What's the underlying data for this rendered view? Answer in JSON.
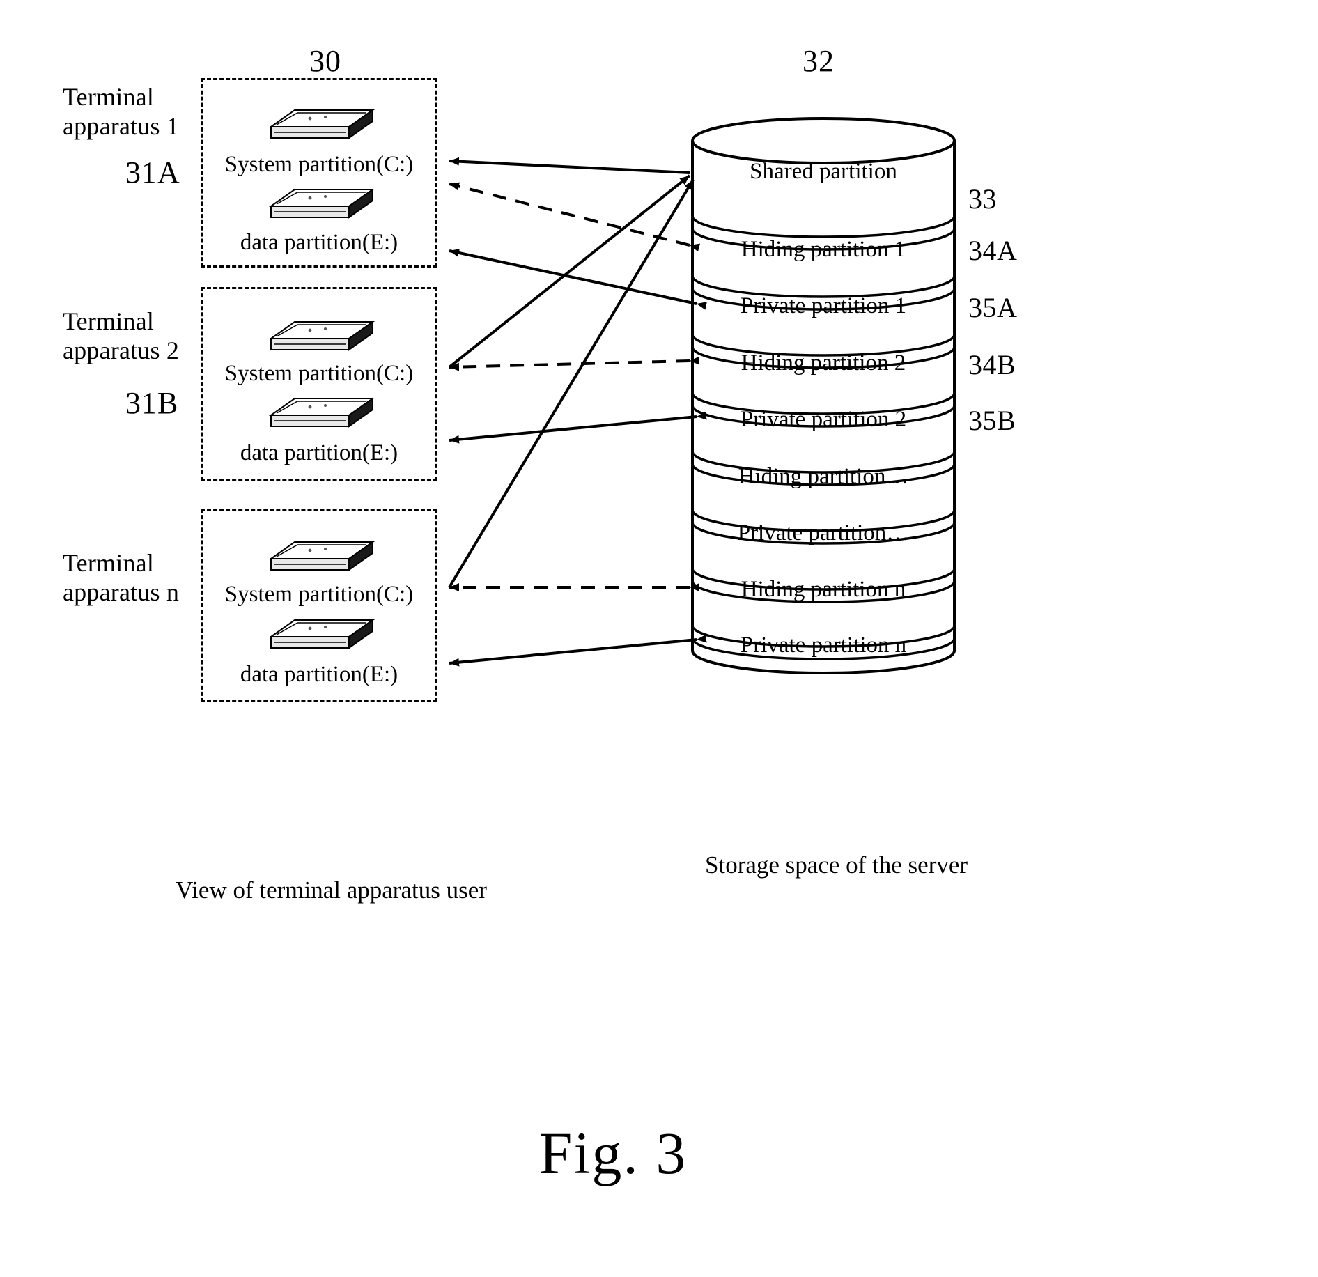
{
  "figure": {
    "number_label": "Fig. 3",
    "top_ref_left": "30",
    "top_ref_right": "32"
  },
  "left_side": {
    "terminals": [
      {
        "name": "Terminal\napparatus 1",
        "ref": "31A"
      },
      {
        "name": "Terminal\napparatus 2",
        "ref": "31B"
      },
      {
        "name": "Terminal\napparatus n",
        "ref": ""
      }
    ],
    "box_partitions": [
      {
        "system": "System partition(C:)",
        "data": "data  partition(E:)"
      },
      {
        "system": "System partition(C:)",
        "data": "data  partition(E:)"
      },
      {
        "system": "System partition(C:)",
        "data": "data  partition(E:)"
      }
    ],
    "caption": "View of terminal apparatus user"
  },
  "server": {
    "caption": "Storage space of the server",
    "partitions": [
      {
        "label": "Shared partition",
        "ref": "33"
      },
      {
        "label": "Hiding partition 1",
        "ref": "34A"
      },
      {
        "label": "Private partition 1",
        "ref": "35A"
      },
      {
        "label": "Hiding partition 2",
        "ref": "34B"
      },
      {
        "label": "Private partition 2",
        "ref": "35B"
      },
      {
        "label": "Hiding partition…",
        "ref": ""
      },
      {
        "label": "Private partition…",
        "ref": ""
      },
      {
        "label": "Hiding partition n",
        "ref": ""
      },
      {
        "label": "Private partition n",
        "ref": ""
      }
    ]
  },
  "icons": {
    "disk": "hard-disk-drive-icon",
    "arrow_solid": "solid-arrow-connector",
    "arrow_dashed": "dashed-arrow-connector"
  },
  "colors": {
    "ink": "#000000",
    "paper": "#ffffff"
  }
}
